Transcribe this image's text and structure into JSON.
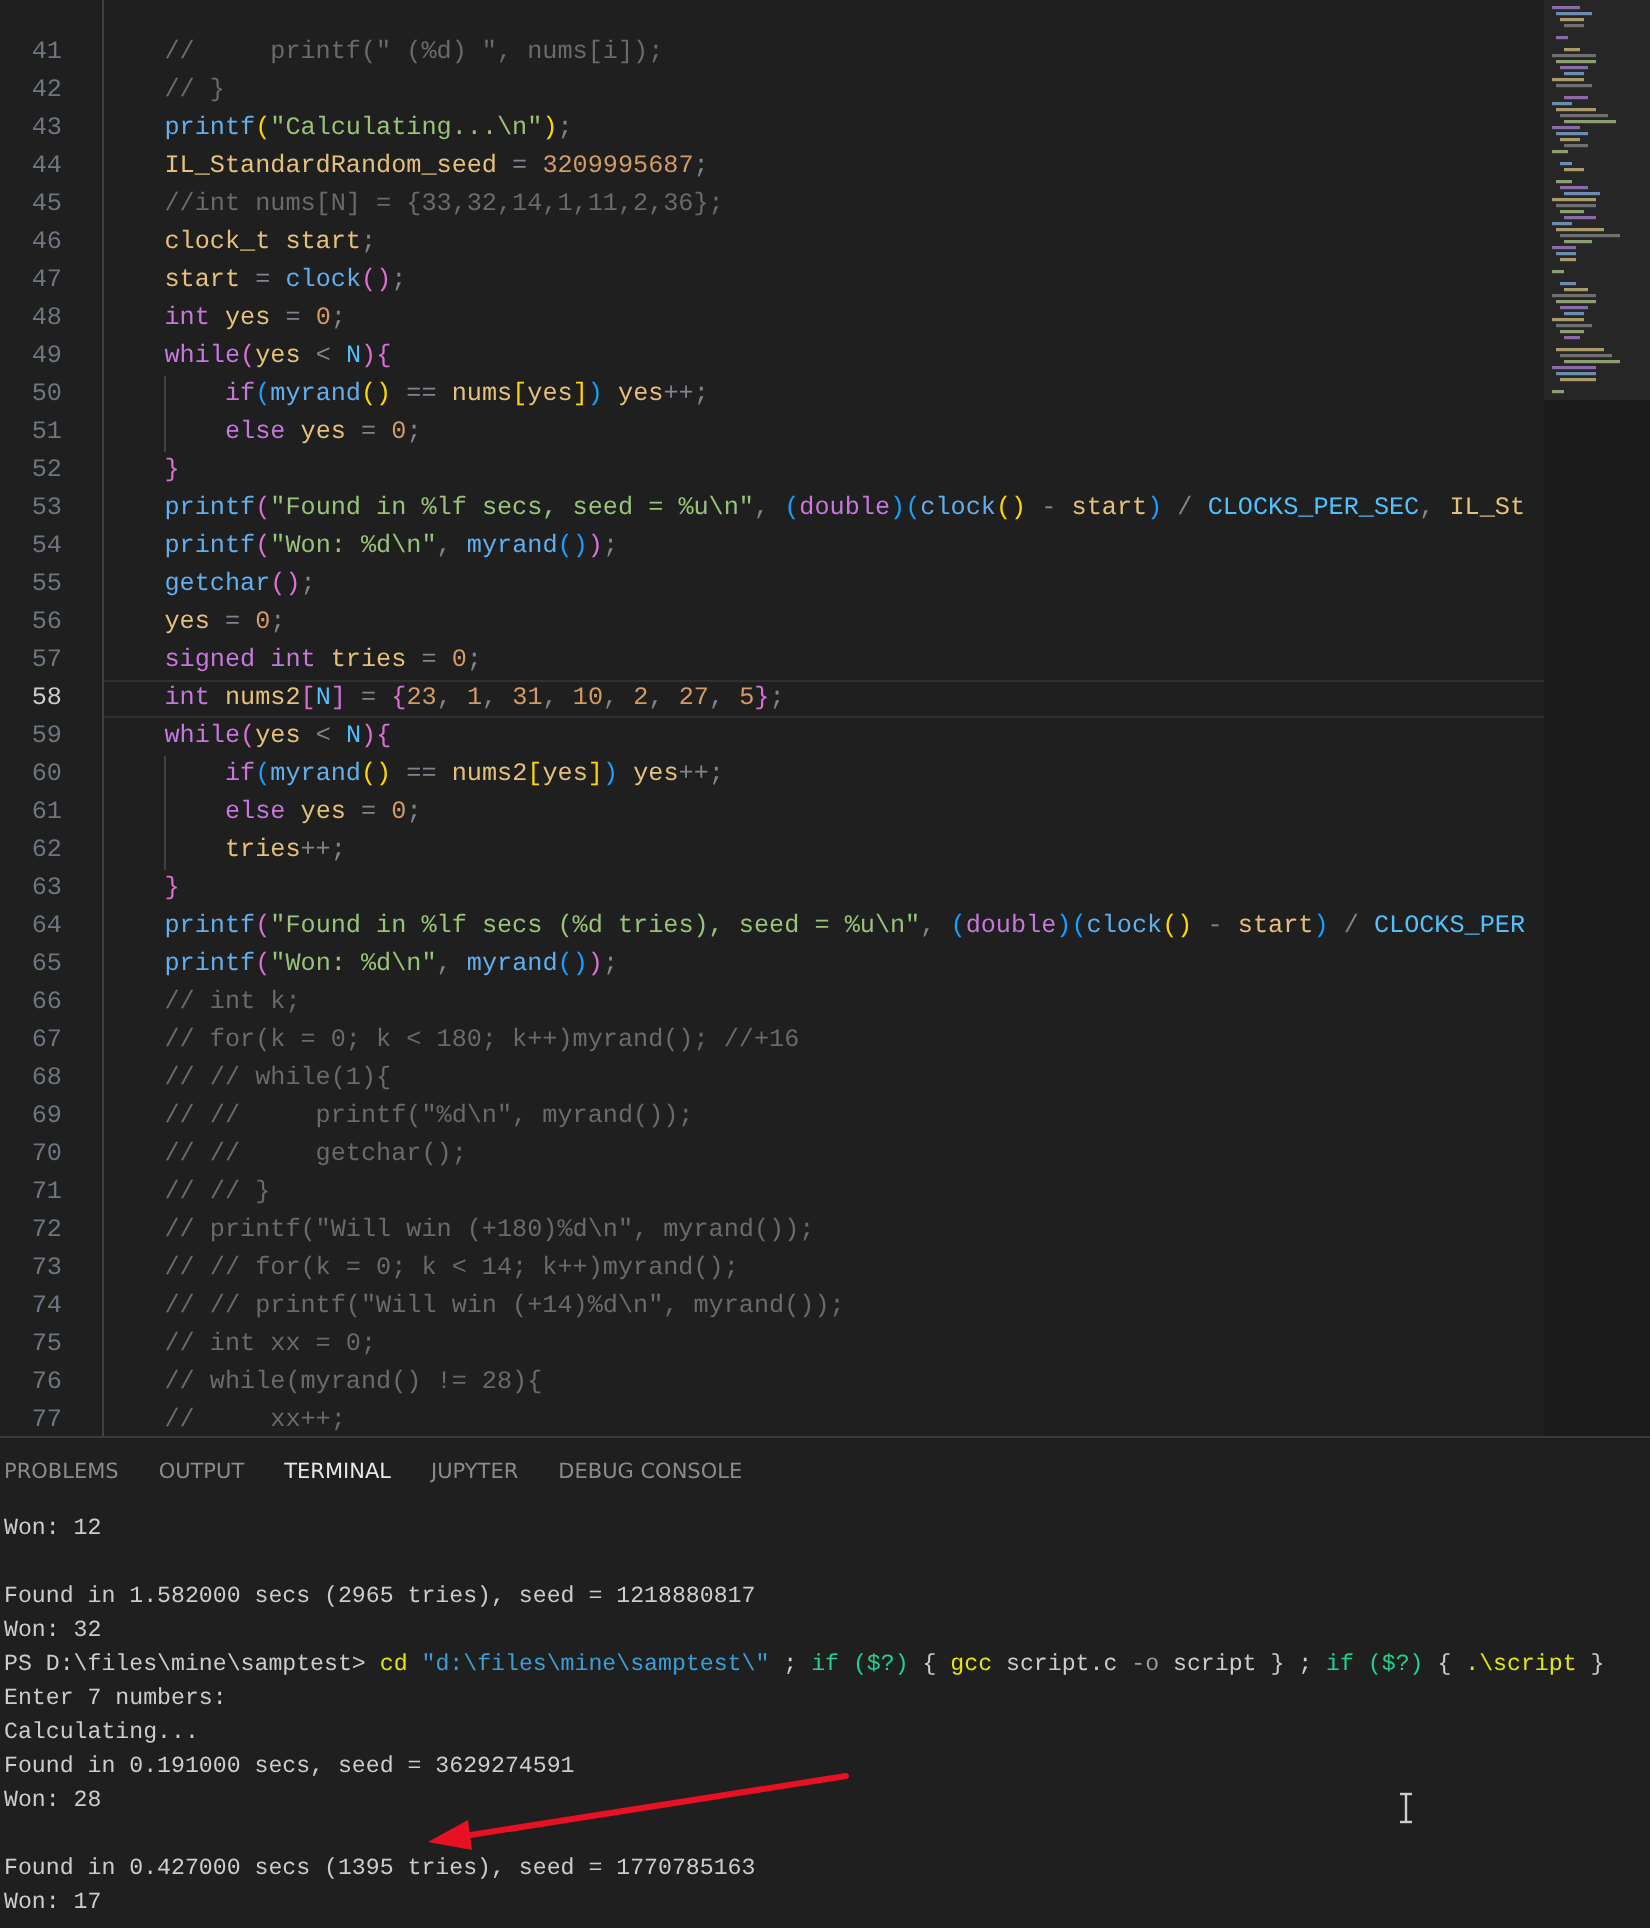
{
  "editor": {
    "lines": [
      {
        "number": "41",
        "current": false,
        "tokens": [
          {
            "text": "    //     printf(\" (%d) \", nums[i]);",
            "kind": "comment"
          }
        ]
      },
      {
        "number": "42",
        "current": false,
        "tokens": [
          {
            "text": "    // }",
            "kind": "comment"
          }
        ]
      },
      {
        "number": "43",
        "current": false,
        "tokens": [
          {
            "text": "    printf",
            "kind": "function"
          },
          {
            "text": "(",
            "kind": "bracket1"
          },
          {
            "text": "\"Calculating...\\n\"",
            "kind": "string"
          },
          {
            "text": ")",
            "kind": "bracket1"
          },
          {
            "text": ";",
            "kind": "operator"
          }
        ]
      },
      {
        "number": "44",
        "current": false,
        "tokens": [
          {
            "text": "    IL_StandardRandom_seed",
            "kind": "variable"
          },
          {
            "text": " = ",
            "kind": "operator"
          },
          {
            "text": "3209995687",
            "kind": "number"
          },
          {
            "text": ";",
            "kind": "operator"
          }
        ]
      },
      {
        "number": "45",
        "current": false,
        "tokens": [
          {
            "text": "    //int nums[N] = {33,32,14,1,11,2,36};",
            "kind": "comment"
          }
        ]
      },
      {
        "number": "46",
        "current": false,
        "tokens": [
          {
            "text": "    clock_t start",
            "kind": "variable"
          },
          {
            "text": ";",
            "kind": "operator"
          }
        ]
      },
      {
        "number": "47",
        "current": false,
        "tokens": [
          {
            "text": "    start",
            "kind": "variable"
          },
          {
            "text": " = ",
            "kind": "operator"
          },
          {
            "text": "clock",
            "kind": "function"
          },
          {
            "text": "()",
            "kind": "bracket2"
          },
          {
            "text": ";",
            "kind": "operator"
          }
        ]
      },
      {
        "number": "48",
        "current": false,
        "tokens": [
          {
            "text": "    int",
            "kind": "keyword"
          },
          {
            "text": " yes",
            "kind": "variable"
          },
          {
            "text": " = ",
            "kind": "operator"
          },
          {
            "text": "0",
            "kind": "number"
          },
          {
            "text": ";",
            "kind": "operator"
          }
        ]
      },
      {
        "number": "49",
        "current": false,
        "tokens": [
          {
            "text": "    while",
            "kind": "keyword"
          },
          {
            "text": "(",
            "kind": "bracket2"
          },
          {
            "text": "yes",
            "kind": "variable"
          },
          {
            "text": " < ",
            "kind": "operator"
          },
          {
            "text": "N",
            "kind": "constant"
          },
          {
            "text": "){",
            "kind": "bracket2"
          }
        ]
      },
      {
        "number": "50",
        "current": false,
        "tokens": [
          {
            "text": "        if",
            "kind": "keyword"
          },
          {
            "text": "(",
            "kind": "bracket3"
          },
          {
            "text": "myrand",
            "kind": "function"
          },
          {
            "text": "()",
            "kind": "bracket1"
          },
          {
            "text": " == ",
            "kind": "operator"
          },
          {
            "text": "nums",
            "kind": "variable"
          },
          {
            "text": "[",
            "kind": "bracket1"
          },
          {
            "text": "yes",
            "kind": "variable"
          },
          {
            "text": "]",
            "kind": "bracket1"
          },
          {
            "text": ")",
            "kind": "bracket3"
          },
          {
            "text": " yes",
            "kind": "variable"
          },
          {
            "text": "++;",
            "kind": "operator"
          }
        ]
      },
      {
        "number": "51",
        "current": false,
        "tokens": [
          {
            "text": "        else",
            "kind": "keyword"
          },
          {
            "text": " yes",
            "kind": "variable"
          },
          {
            "text": " = ",
            "kind": "operator"
          },
          {
            "text": "0",
            "kind": "number"
          },
          {
            "text": ";",
            "kind": "operator"
          }
        ]
      },
      {
        "number": "52",
        "current": false,
        "tokens": [
          {
            "text": "    }",
            "kind": "bracket2"
          }
        ]
      },
      {
        "number": "53",
        "current": false,
        "tokens": [
          {
            "text": "    printf",
            "kind": "function"
          },
          {
            "text": "(",
            "kind": "bracket2"
          },
          {
            "text": "\"Found in %lf secs, seed = %u\\n\"",
            "kind": "string"
          },
          {
            "text": ", ",
            "kind": "operator"
          },
          {
            "text": "(",
            "kind": "bracket3"
          },
          {
            "text": "double",
            "kind": "keyword"
          },
          {
            "text": ")(",
            "kind": "bracket3"
          },
          {
            "text": "clock",
            "kind": "function"
          },
          {
            "text": "()",
            "kind": "bracket1"
          },
          {
            "text": " - ",
            "kind": "operator"
          },
          {
            "text": "start",
            "kind": "variable"
          },
          {
            "text": ")",
            "kind": "bracket3"
          },
          {
            "text": " / ",
            "kind": "operator"
          },
          {
            "text": "CLOCKS_PER_SEC",
            "kind": "constant"
          },
          {
            "text": ", ",
            "kind": "operator"
          },
          {
            "text": "IL_St",
            "kind": "variable"
          }
        ]
      },
      {
        "number": "54",
        "current": false,
        "tokens": [
          {
            "text": "    printf",
            "kind": "function"
          },
          {
            "text": "(",
            "kind": "bracket2"
          },
          {
            "text": "\"Won: %d\\n\"",
            "kind": "string"
          },
          {
            "text": ", ",
            "kind": "operator"
          },
          {
            "text": "myrand",
            "kind": "function"
          },
          {
            "text": "()",
            "kind": "bracket3"
          },
          {
            "text": ")",
            "kind": "bracket2"
          },
          {
            "text": ";",
            "kind": "operator"
          }
        ]
      },
      {
        "number": "55",
        "current": false,
        "tokens": [
          {
            "text": "    getchar",
            "kind": "function"
          },
          {
            "text": "()",
            "kind": "bracket2"
          },
          {
            "text": ";",
            "kind": "operator"
          }
        ]
      },
      {
        "number": "56",
        "current": false,
        "tokens": [
          {
            "text": "    yes",
            "kind": "variable"
          },
          {
            "text": " = ",
            "kind": "operator"
          },
          {
            "text": "0",
            "kind": "number"
          },
          {
            "text": ";",
            "kind": "operator"
          }
        ]
      },
      {
        "number": "57",
        "current": false,
        "tokens": [
          {
            "text": "    signed int",
            "kind": "keyword"
          },
          {
            "text": " tries",
            "kind": "variable"
          },
          {
            "text": " = ",
            "kind": "operator"
          },
          {
            "text": "0",
            "kind": "number"
          },
          {
            "text": ";",
            "kind": "operator"
          }
        ]
      },
      {
        "number": "58",
        "current": true,
        "tokens": [
          {
            "text": "    int",
            "kind": "keyword"
          },
          {
            "text": " nums2",
            "kind": "variable"
          },
          {
            "text": "[",
            "kind": "bracket2"
          },
          {
            "text": "N",
            "kind": "constant"
          },
          {
            "text": "]",
            "kind": "bracket2"
          },
          {
            "text": " = ",
            "kind": "operator"
          },
          {
            "text": "{",
            "kind": "bracket2"
          },
          {
            "text": "23",
            "kind": "number"
          },
          {
            "text": ", ",
            "kind": "operator"
          },
          {
            "text": "1",
            "kind": "number"
          },
          {
            "text": ", ",
            "kind": "operator"
          },
          {
            "text": "31",
            "kind": "number"
          },
          {
            "text": ", ",
            "kind": "operator"
          },
          {
            "text": "10",
            "kind": "number"
          },
          {
            "text": ", ",
            "kind": "operator"
          },
          {
            "text": "2",
            "kind": "number"
          },
          {
            "text": ", ",
            "kind": "operator"
          },
          {
            "text": "27",
            "kind": "number"
          },
          {
            "text": ", ",
            "kind": "operator"
          },
          {
            "text": "5",
            "kind": "number"
          },
          {
            "text": "}",
            "kind": "bracket2"
          },
          {
            "text": ";",
            "kind": "operator"
          }
        ]
      },
      {
        "number": "59",
        "current": false,
        "tokens": [
          {
            "text": "    while",
            "kind": "keyword"
          },
          {
            "text": "(",
            "kind": "bracket2"
          },
          {
            "text": "yes",
            "kind": "variable"
          },
          {
            "text": " < ",
            "kind": "operator"
          },
          {
            "text": "N",
            "kind": "constant"
          },
          {
            "text": "){",
            "kind": "bracket2"
          }
        ]
      },
      {
        "number": "60",
        "current": false,
        "tokens": [
          {
            "text": "        if",
            "kind": "keyword"
          },
          {
            "text": "(",
            "kind": "bracket3"
          },
          {
            "text": "myrand",
            "kind": "function"
          },
          {
            "text": "()",
            "kind": "bracket1"
          },
          {
            "text": " == ",
            "kind": "operator"
          },
          {
            "text": "nums2",
            "kind": "variable"
          },
          {
            "text": "[",
            "kind": "bracket1"
          },
          {
            "text": "yes",
            "kind": "variable"
          },
          {
            "text": "]",
            "kind": "bracket1"
          },
          {
            "text": ")",
            "kind": "bracket3"
          },
          {
            "text": " yes",
            "kind": "variable"
          },
          {
            "text": "++;",
            "kind": "operator"
          }
        ]
      },
      {
        "number": "61",
        "current": false,
        "tokens": [
          {
            "text": "        else",
            "kind": "keyword"
          },
          {
            "text": " yes",
            "kind": "variable"
          },
          {
            "text": " = ",
            "kind": "operator"
          },
          {
            "text": "0",
            "kind": "number"
          },
          {
            "text": ";",
            "kind": "operator"
          }
        ]
      },
      {
        "number": "62",
        "current": false,
        "tokens": [
          {
            "text": "        tries",
            "kind": "variable"
          },
          {
            "text": "++;",
            "kind": "operator"
          }
        ]
      },
      {
        "number": "63",
        "current": false,
        "tokens": [
          {
            "text": "    }",
            "kind": "bracket2"
          }
        ]
      },
      {
        "number": "64",
        "current": false,
        "tokens": [
          {
            "text": "    printf",
            "kind": "function"
          },
          {
            "text": "(",
            "kind": "bracket2"
          },
          {
            "text": "\"Found in %lf secs (%d tries), seed = %u\\n\"",
            "kind": "string"
          },
          {
            "text": ", ",
            "kind": "operator"
          },
          {
            "text": "(",
            "kind": "bracket3"
          },
          {
            "text": "double",
            "kind": "keyword"
          },
          {
            "text": ")(",
            "kind": "bracket3"
          },
          {
            "text": "clock",
            "kind": "function"
          },
          {
            "text": "()",
            "kind": "bracket1"
          },
          {
            "text": " - ",
            "kind": "operator"
          },
          {
            "text": "start",
            "kind": "variable"
          },
          {
            "text": ")",
            "kind": "bracket3"
          },
          {
            "text": " / ",
            "kind": "operator"
          },
          {
            "text": "CLOCKS_PER",
            "kind": "constant"
          }
        ]
      },
      {
        "number": "65",
        "current": false,
        "tokens": [
          {
            "text": "    printf",
            "kind": "function"
          },
          {
            "text": "(",
            "kind": "bracket2"
          },
          {
            "text": "\"Won: %d\\n\"",
            "kind": "string"
          },
          {
            "text": ", ",
            "kind": "operator"
          },
          {
            "text": "myrand",
            "kind": "function"
          },
          {
            "text": "()",
            "kind": "bracket3"
          },
          {
            "text": ")",
            "kind": "bracket2"
          },
          {
            "text": ";",
            "kind": "operator"
          }
        ]
      },
      {
        "number": "66",
        "current": false,
        "tokens": [
          {
            "text": "    // int k;",
            "kind": "comment"
          }
        ]
      },
      {
        "number": "67",
        "current": false,
        "tokens": [
          {
            "text": "    // for(k = 0; k < 180; k++)myrand(); //+16",
            "kind": "comment"
          }
        ]
      },
      {
        "number": "68",
        "current": false,
        "tokens": [
          {
            "text": "    // // while(1){",
            "kind": "comment"
          }
        ]
      },
      {
        "number": "69",
        "current": false,
        "tokens": [
          {
            "text": "    // //     printf(\"%d\\n\", myrand());",
            "kind": "comment"
          }
        ]
      },
      {
        "number": "70",
        "current": false,
        "tokens": [
          {
            "text": "    // //     getchar();",
            "kind": "comment"
          }
        ]
      },
      {
        "number": "71",
        "current": false,
        "tokens": [
          {
            "text": "    // // }",
            "kind": "comment"
          }
        ]
      },
      {
        "number": "72",
        "current": false,
        "tokens": [
          {
            "text": "    // printf(\"Will win (+180)%d\\n\", myrand());",
            "kind": "comment"
          }
        ]
      },
      {
        "number": "73",
        "current": false,
        "tokens": [
          {
            "text": "    // // for(k = 0; k < 14; k++)myrand();",
            "kind": "comment"
          }
        ]
      },
      {
        "number": "74",
        "current": false,
        "tokens": [
          {
            "text": "    // // printf(\"Will win (+14)%d\\n\", myrand());",
            "kind": "comment"
          }
        ]
      },
      {
        "number": "75",
        "current": false,
        "tokens": [
          {
            "text": "    // int xx = 0;",
            "kind": "comment"
          }
        ]
      },
      {
        "number": "76",
        "current": false,
        "tokens": [
          {
            "text": "    // while(myrand() != 28){",
            "kind": "comment"
          }
        ]
      },
      {
        "number": "77",
        "current": false,
        "tokens": [
          {
            "text": "    //     xx++;",
            "kind": "comment"
          }
        ]
      }
    ]
  },
  "panel": {
    "tabs": [
      {
        "label": "PROBLEMS",
        "selected": false
      },
      {
        "label": "OUTPUT",
        "selected": false
      },
      {
        "label": "TERMINAL",
        "selected": true
      },
      {
        "label": "JUPYTER",
        "selected": false
      },
      {
        "label": "DEBUG CONSOLE",
        "selected": false
      }
    ],
    "terminal_lines": [
      {
        "kind": "text",
        "tokens": [
          {
            "text": "Won: 12",
            "kind": "plain"
          }
        ]
      },
      {
        "kind": "blank"
      },
      {
        "kind": "text",
        "tokens": [
          {
            "text": "Found in 1.582000 secs (2965 tries), seed = 1218880817",
            "kind": "plain"
          }
        ]
      },
      {
        "kind": "text",
        "tokens": [
          {
            "text": "Won: 32",
            "kind": "plain"
          }
        ]
      },
      {
        "kind": "text",
        "tokens": [
          {
            "text": "PS D:\\files\\mine\\samptest> ",
            "kind": "plain"
          },
          {
            "text": "cd",
            "kind": "command"
          },
          {
            "text": " \"d:\\files\\mine\\samptest\\\"",
            "kind": "string"
          },
          {
            "text": " ; ",
            "kind": "plain"
          },
          {
            "text": "if",
            "kind": "keyword"
          },
          {
            "text": " ($?)",
            "kind": "variable"
          },
          {
            "text": " { ",
            "kind": "plain"
          },
          {
            "text": "gcc",
            "kind": "command"
          },
          {
            "text": " script.c ",
            "kind": "plain"
          },
          {
            "text": "-o",
            "kind": "parameter"
          },
          {
            "text": " script } ; ",
            "kind": "plain"
          },
          {
            "text": "if",
            "kind": "keyword"
          },
          {
            "text": " ($?)",
            "kind": "variable"
          },
          {
            "text": " { ",
            "kind": "plain"
          },
          {
            "text": ".\\script",
            "kind": "command"
          },
          {
            "text": " }",
            "kind": "plain"
          }
        ]
      },
      {
        "kind": "text",
        "tokens": [
          {
            "text": "Enter 7 numbers:",
            "kind": "plain"
          }
        ]
      },
      {
        "kind": "text",
        "tokens": [
          {
            "text": "Calculating...",
            "kind": "plain"
          }
        ]
      },
      {
        "kind": "text",
        "tokens": [
          {
            "text": "Found in 0.191000 secs, seed = 3629274591",
            "kind": "plain"
          }
        ]
      },
      {
        "kind": "text",
        "tokens": [
          {
            "text": "Won: 28",
            "kind": "plain"
          }
        ]
      },
      {
        "kind": "blank"
      },
      {
        "kind": "text",
        "tokens": [
          {
            "text": "Found in 0.427000 secs (1395 tries), seed = 1770785163",
            "kind": "plain"
          }
        ]
      },
      {
        "kind": "text",
        "tokens": [
          {
            "text": "Won: 17",
            "kind": "plain"
          }
        ]
      }
    ]
  }
}
